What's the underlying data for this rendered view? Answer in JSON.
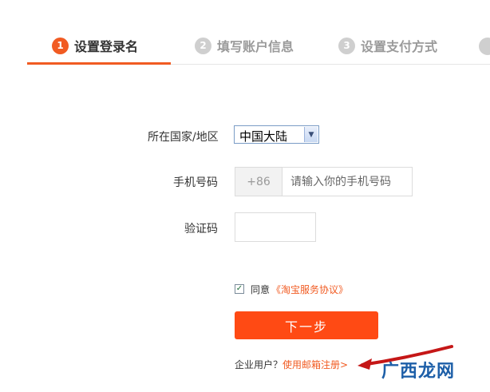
{
  "steps": [
    {
      "num": "1",
      "label": "设置登录名",
      "state": "active"
    },
    {
      "num": "2",
      "label": "填写账户信息",
      "state": "inactive"
    },
    {
      "num": "3",
      "label": "设置支付方式",
      "state": "inactive"
    }
  ],
  "form": {
    "country_label": "所在国家/地区",
    "country_value": "中国大陆",
    "phone_label": "手机号码",
    "phone_prefix": "+86",
    "phone_placeholder": "请输入你的手机号码",
    "code_label": "验证码",
    "code_value": ""
  },
  "agreement": {
    "checked": true,
    "text": "同意",
    "link": "《淘宝服务协议》"
  },
  "next_button": "下一步",
  "enterprise": {
    "text": "企业用户？",
    "link": "使用邮箱注册>"
  },
  "watermark": {
    "logo": "广西龙网"
  },
  "colors": {
    "accent": "#f15b22",
    "button": "#ff4a14",
    "inactive_step": "#cfcfcf"
  }
}
